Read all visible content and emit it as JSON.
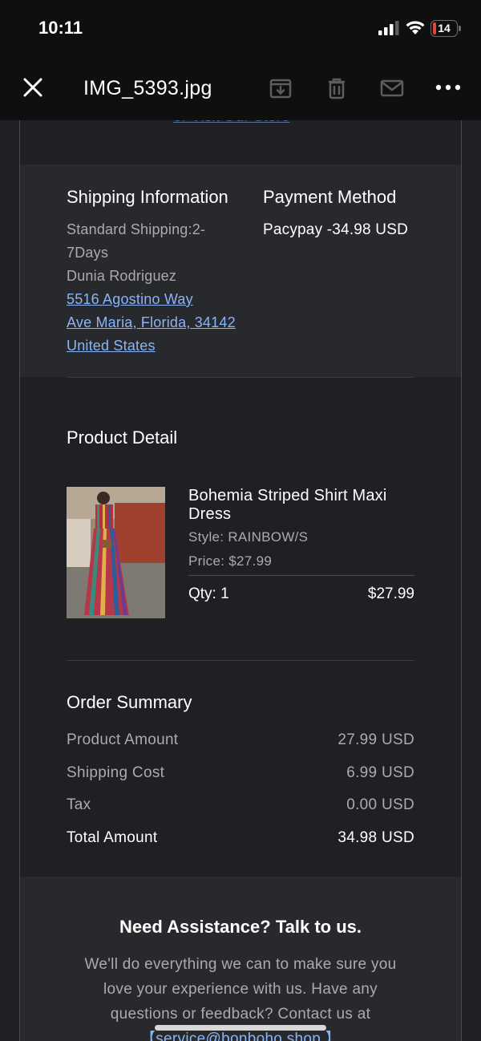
{
  "status_bar": {
    "time": "10:11",
    "battery": "14",
    "battery_level": 0.14,
    "signal_icon": "signal-bars-icon",
    "wifi_icon": "wifi-icon"
  },
  "viewer": {
    "file_name": "IMG_5393.jpg",
    "icons": [
      "close-icon",
      "archive-icon",
      "trash-icon",
      "mail-icon",
      "more-icon"
    ]
  },
  "email": {
    "visit_link": "or Visit Our Store",
    "shipping": {
      "title": "Shipping Information",
      "method_line1": "Standard Shipping:2-",
      "method_line2": "7Days",
      "name": "Dunia Rodriguez",
      "address1": "5516 Agostino Way",
      "address2": "Ave Maria, Florida, 34142",
      "country": "United States"
    },
    "payment": {
      "title": "Payment Method",
      "value": "Pacypay  -34.98 USD"
    },
    "product": {
      "section_title": "Product Detail",
      "name": "Bohemia Striped Shirt Maxi Dress",
      "style": "Style: RAINBOW/S",
      "price": "Price: $27.99",
      "qty": "Qty: 1",
      "line_total": "$27.99"
    },
    "summary": {
      "title": "Order Summary",
      "rows": [
        {
          "label": "Product Amount",
          "value": "27.99 USD"
        },
        {
          "label": "Shipping Cost",
          "value": "6.99 USD"
        },
        {
          "label": "Tax",
          "value": "0.00 USD"
        },
        {
          "label": "Total Amount",
          "value": "34.98 USD"
        }
      ]
    },
    "assistance": {
      "title": "Need Assistance? Talk to us.",
      "text": "We'll do everything we can to make sure you love your experience with us. Have any questions or feedback? Contact us at ",
      "link": "【service@bonboho.shop 】"
    }
  },
  "colors": {
    "link": "#8ab4f8",
    "background": "#1f2023",
    "panel": "#28292c",
    "battery_low": "#e0443e"
  }
}
